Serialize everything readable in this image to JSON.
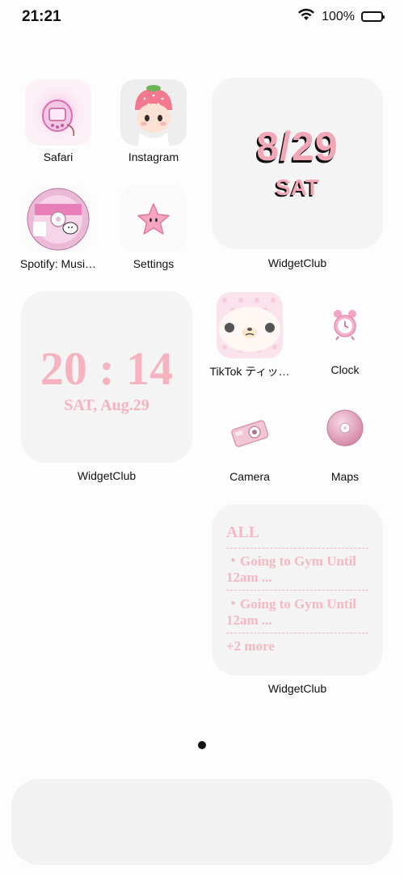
{
  "status_bar": {
    "time": "21:21",
    "battery": "100%"
  },
  "apps": {
    "safari": "Safari",
    "instagram": "Instagram",
    "spotify": "Spotify: Musi…",
    "settings": "Settings",
    "tiktok": "TikTok ティッ…",
    "clock": "Clock",
    "camera": "Camera",
    "maps": "Maps"
  },
  "widgets": {
    "date": {
      "date": "8/29",
      "day": "SAT",
      "label": "WidgetClub"
    },
    "clock": {
      "time": "20 : 14",
      "date": "SAT, Aug.29",
      "label": "WidgetClub"
    },
    "todo": {
      "heading": "ALL",
      "items": [
        "・Going to Gym Until 12am ...",
        "・Going to Gym Until 12am ..."
      ],
      "more": "+2 more",
      "label": "WidgetClub"
    }
  },
  "colors": {
    "accent_pink": "#f4b3bf",
    "background": "#fdfdfd",
    "widget_bg": "#f4f4f4"
  }
}
